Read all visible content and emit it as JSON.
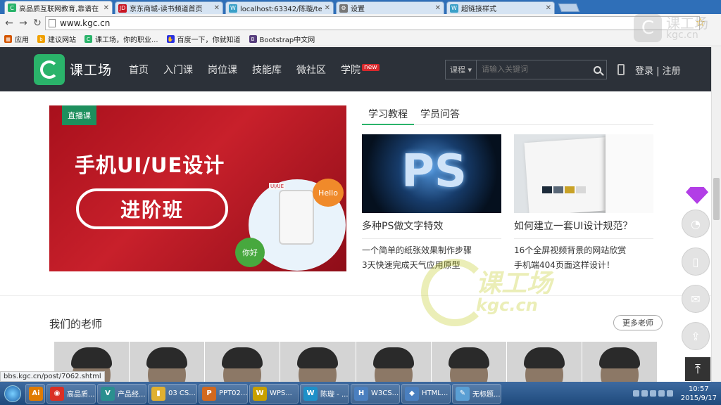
{
  "browser": {
    "tabs": [
      {
        "title": "高品质互联网教育,靠谱在",
        "icon": "kgc-favicon-icon",
        "color": "#2ab36a",
        "glyph": "C"
      },
      {
        "title": "京东商城-读书频道首页",
        "icon": "jd-favicon-icon",
        "color": "#c91623",
        "glyph": "JD"
      },
      {
        "title": "localhost:63342/陈璇/te",
        "icon": "webstorm-favicon-icon",
        "color": "#3aa0c8",
        "glyph": "W"
      },
      {
        "title": "设置",
        "icon": "gear-icon",
        "color": "#777777",
        "glyph": "⚙"
      },
      {
        "title": "超链接样式",
        "icon": "webstorm-favicon-icon",
        "color": "#3aa0c8",
        "glyph": "W"
      }
    ],
    "url": "www.kgc.cn",
    "bookmarks": [
      {
        "label": "应用",
        "icon": "apps-grid-icon",
        "color": "#d45500",
        "glyph": "▦"
      },
      {
        "label": "建议网站",
        "icon": "bing-icon",
        "color": "#f0a000",
        "glyph": "b"
      },
      {
        "label": "课工场，你的职业...",
        "icon": "kgc-favicon-icon",
        "color": "#2ab36a",
        "glyph": "C"
      },
      {
        "label": "百度一下，你就知道",
        "icon": "baidu-paw-icon",
        "color": "#2932e1",
        "glyph": "✋"
      },
      {
        "label": "Bootstrap中文网",
        "icon": "bootstrap-icon",
        "color": "#563d7c",
        "glyph": "B"
      }
    ]
  },
  "watermark_corner": {
    "name": "课工场",
    "domain": "kgc.cn"
  },
  "site": {
    "brand": "课工场",
    "nav": [
      "首页",
      "入门课",
      "岗位课",
      "技能库",
      "微社区",
      "学院"
    ],
    "new_badge": "new",
    "search_category": "课程",
    "search_placeholder": "请输入关键词",
    "login": "登录 | 注册"
  },
  "banner": {
    "tag": "直播课",
    "headline": "手机UI/UE设计",
    "pill": "进阶班",
    "hello": "Hello",
    "nihao": "你好",
    "uiue": "UI/UE"
  },
  "tutorials": {
    "tabs": [
      "学习教程",
      "学员问答"
    ],
    "cards": [
      {
        "title": "多种PS做文字特效",
        "image_text": "PS",
        "links": [
          "一个简单的纸张效果制作步骤",
          "3天快速完成天气应用原型"
        ]
      },
      {
        "title": "如何建立一套UI设计规范？",
        "links": [
          "16个全屏视频背景的网站欣赏",
          "手机端404页面这样设计！"
        ]
      }
    ]
  },
  "teachers": {
    "heading": "我们的老师",
    "more": "更多老师",
    "count": 8
  },
  "page_watermark": {
    "brand": "课工场",
    "domain": "kgc.cn"
  },
  "status_url": "bbs.kgc.cn/post/7062.shtml",
  "taskbar": {
    "items": [
      {
        "label": "",
        "icon": "illustrator-icon",
        "color": "#e07b00",
        "glyph": "Ai"
      },
      {
        "label": "高品质...",
        "icon": "chrome-icon",
        "color": "#d93025",
        "glyph": "◉"
      },
      {
        "label": "产品经...",
        "icon": "app-v-icon",
        "color": "#2a8f8f",
        "glyph": "V"
      },
      {
        "label": "03 CS...",
        "icon": "folder-icon",
        "color": "#e0b030",
        "glyph": "▮"
      },
      {
        "label": "PPT02...",
        "icon": "powerpoint-icon",
        "color": "#d2691e",
        "glyph": "P"
      },
      {
        "label": "WPS...",
        "icon": "wps-icon",
        "color": "#c8a000",
        "glyph": "W"
      },
      {
        "label": "陈璇 - ...",
        "icon": "webstorm-icon",
        "color": "#1e90c8",
        "glyph": "W"
      },
      {
        "label": "W3CS...",
        "icon": "html-doc-icon",
        "color": "#4a7fbf",
        "glyph": "H"
      },
      {
        "label": "HTML...",
        "icon": "html-doc-icon",
        "color": "#4a7fbf",
        "glyph": "◆"
      },
      {
        "label": "无标题...",
        "icon": "paint-icon",
        "color": "#5a9fd4",
        "glyph": "✎"
      }
    ],
    "time": "10:57",
    "date": "2015/9/17"
  }
}
